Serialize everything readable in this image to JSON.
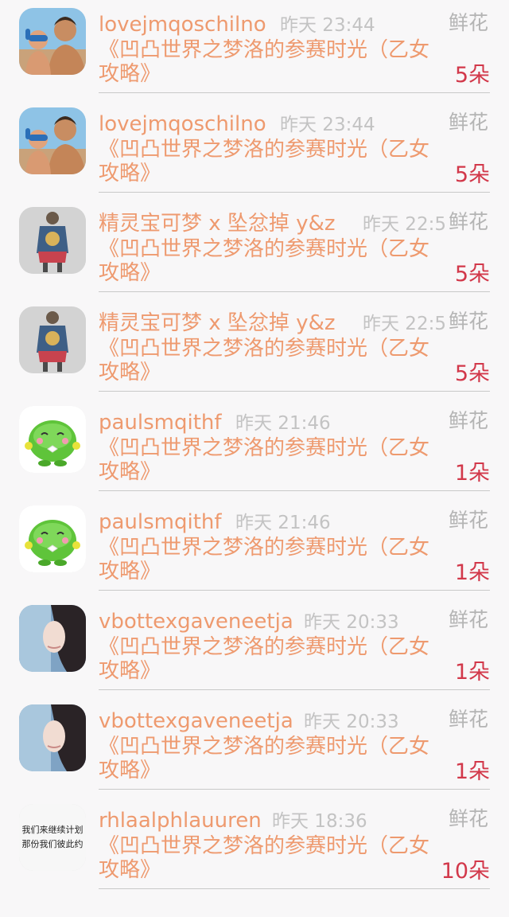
{
  "items": [
    {
      "username": "lovejmqoschilno",
      "time": "昨天 23:44",
      "gift": "鲜花",
      "title": "《凹凸世界之梦洛的参赛时光（乙女攻略》",
      "count": "5朵",
      "avatar": "beach-photo-avatar"
    },
    {
      "username": "lovejmqoschilno",
      "time": "昨天 23:44",
      "gift": "鲜花",
      "title": "《凹凸世界之梦洛的参赛时光（乙女攻略》",
      "count": "5朵",
      "avatar": "beach-photo-avatar"
    },
    {
      "username": "精灵宝可梦 x 坠忿掉 y&z",
      "time": "昨天 22:5",
      "gift": "鲜花",
      "title": "《凹凸世界之梦洛的参赛时光（乙女攻略》",
      "count": "5朵",
      "avatar": "denim-jacket-avatar"
    },
    {
      "username": "精灵宝可梦 x 坠忿掉 y&z",
      "time": "昨天 22:5",
      "gift": "鲜花",
      "title": "《凹凸世界之梦洛的参赛时光（乙女攻略》",
      "count": "5朵",
      "avatar": "denim-jacket-avatar"
    },
    {
      "username": "paulsmqithf",
      "time": "昨天 21:46",
      "gift": "鲜花",
      "title": "《凹凸世界之梦洛的参赛时光（乙女攻略》",
      "count": "1朵",
      "avatar": "green-bean-cartoon-avatar"
    },
    {
      "username": "paulsmqithf",
      "time": "昨天 21:46",
      "gift": "鲜花",
      "title": "《凹凸世界之梦洛的参赛时光（乙女攻略》",
      "count": "1朵",
      "avatar": "green-bean-cartoon-avatar"
    },
    {
      "username": "vbottexgaveneetja",
      "time": "昨天 20:33",
      "gift": "鲜花",
      "title": "《凹凸世界之梦洛的参赛时光（乙女攻略》",
      "count": "1朵",
      "avatar": "girl-portrait-avatar"
    },
    {
      "username": "vbottexgaveneetja",
      "time": "昨天 20:33",
      "gift": "鲜花",
      "title": "《凹凸世界之梦洛的参赛时光（乙女攻略》",
      "count": "1朵",
      "avatar": "girl-portrait-avatar"
    },
    {
      "username": "rhlaalphlauuren",
      "time": "昨天 18:36",
      "gift": "鲜花",
      "title": "《凹凸世界之梦洛的参赛时光（乙女攻略》",
      "count": "10朵",
      "avatar": "calligraphy-avatar"
    }
  ],
  "avatar_text": {
    "calligraphy_line1": "我们来继续计划",
    "calligraphy_line2": "那份我们彼此约"
  },
  "colors": {
    "username": "#ee9a6f",
    "title": "#ee9a6f",
    "time": "#c3c3c3",
    "gift_label": "#b4b4b4",
    "count": "#d2384a",
    "divider": "#c9c9c9",
    "background": "#f8f7f8"
  }
}
